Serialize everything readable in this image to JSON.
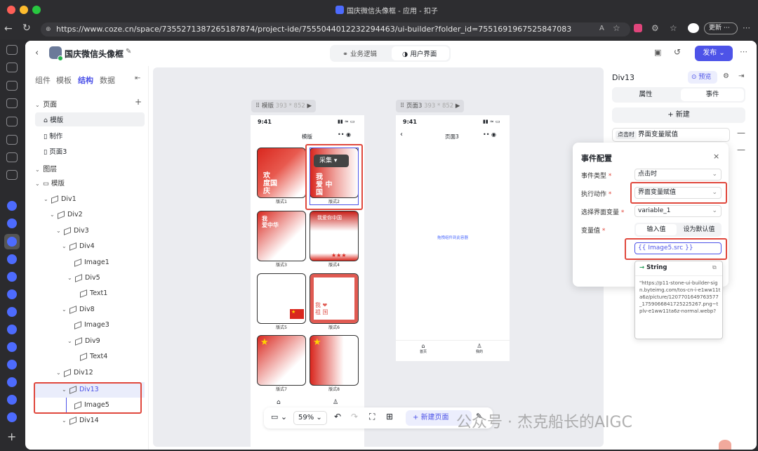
{
  "browser": {
    "window_title": "国庆微信头像框 - 应用 - 扣子",
    "url": "https://www.coze.cn/space/7355271387265187874/project-ide/7555044012232294463/ui-builder?folder_id=7551691967525847083",
    "update_label": "更新"
  },
  "app": {
    "project_name": "国庆微信头像框",
    "mode_tabs": [
      "业务逻辑",
      "用户界面"
    ],
    "publish_label": "发布"
  },
  "left": {
    "tabs": [
      "组件",
      "模板",
      "结构",
      "数据"
    ],
    "pages_title": "页面",
    "pages": [
      "模版",
      "制作",
      "页面3"
    ],
    "layers_title": "图层",
    "tree": [
      {
        "label": "模版"
      },
      {
        "label": "Div1"
      },
      {
        "label": "Div2"
      },
      {
        "label": "Div3"
      },
      {
        "label": "Div4"
      },
      {
        "label": "Image1"
      },
      {
        "label": "Div5"
      },
      {
        "label": "Text1"
      },
      {
        "label": "Div8"
      },
      {
        "label": "Image3"
      },
      {
        "label": "Div9"
      },
      {
        "label": "Text4"
      },
      {
        "label": "Div12"
      },
      {
        "label": "Div13"
      },
      {
        "label": "Image5"
      },
      {
        "label": "Div14"
      }
    ]
  },
  "canvas": {
    "frame1_label": "模版",
    "frame1_size": "393 * 852",
    "frame2_label": "页面3",
    "frame2_size": "393 * 852",
    "time": "9:41",
    "page1_title": "模版",
    "page3_title": "页面3",
    "collect_label": "采集",
    "thumb_labels": [
      "版式1",
      "版式2",
      "版式3",
      "版式4",
      "版式5",
      "版式6",
      "版式7",
      "版式8"
    ],
    "placeholder_text": "拖拽组件到此容器",
    "nav_home": "首页",
    "nav_mine": "我的",
    "zoom": "59%",
    "new_page_label": "新建页面"
  },
  "right": {
    "component_name": "Div13",
    "preview_label": "预览",
    "tabs": [
      "属性",
      "事件"
    ],
    "new_label": "新建",
    "event_tag": "点击时",
    "event_action": "界面变量赋值"
  },
  "event_dialog": {
    "title": "事件配置",
    "fields": [
      {
        "label": "事件类型",
        "value": "点击时"
      },
      {
        "label": "执行动作",
        "value": "界面变量赋值"
      },
      {
        "label": "选择界面变量",
        "value": "variable_1"
      }
    ],
    "var_label": "变量值",
    "var_tabs": [
      "输入值",
      "设为默认值"
    ],
    "expression": "{{ Image5.src }}",
    "type_label": "String",
    "url_preview": "\"https://p11-stone-ui-builder-sign.byteimg.com/tos-cn-i-e1ww11ta6z/picture/1207701649763577_1759066841725225267.png~tplv-e1ww11ta6z-normal.webp?"
  },
  "watermark": "公众号 · 杰克船长的AIGC",
  "colors": {
    "accent": "#4d53e8",
    "highlight": "#e0483d",
    "flag_red": "#d9271e"
  }
}
